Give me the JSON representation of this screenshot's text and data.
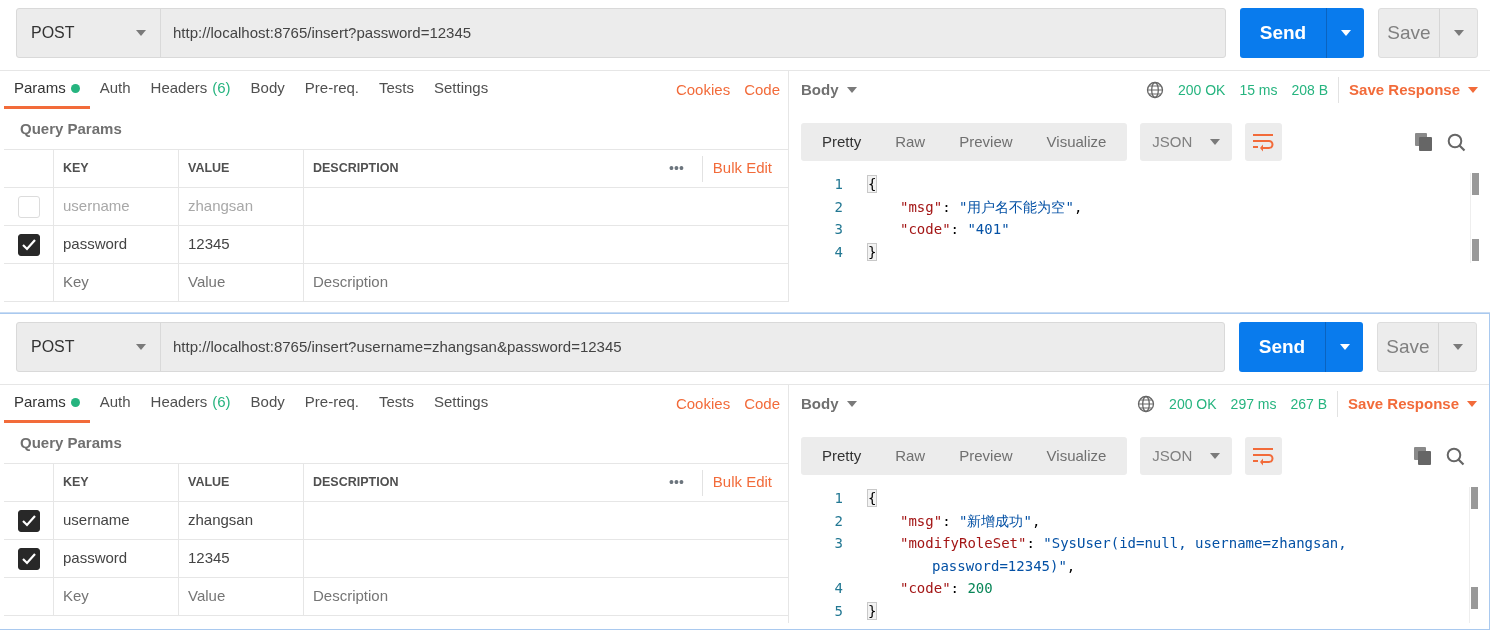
{
  "panels": [
    {
      "method": "POST",
      "url": "http://localhost:8765/insert?password=12345",
      "send": "Send",
      "save": "Save",
      "tabs": [
        {
          "label": "Params",
          "dot": true,
          "selected": true
        },
        {
          "label": "Auth",
          "selected": false
        },
        {
          "label": "Headers",
          "count": "(6)",
          "selected": false
        },
        {
          "label": "Body",
          "selected": false
        },
        {
          "label": "Pre-req.",
          "selected": false
        },
        {
          "label": "Tests",
          "selected": false
        },
        {
          "label": "Settings",
          "selected": false
        }
      ],
      "links": [
        "Cookies",
        "Code"
      ],
      "section_title": "Query Params",
      "columns": [
        "KEY",
        "VALUE",
        "DESCRIPTION"
      ],
      "more": "•••",
      "bulk_edit": "Bulk Edit",
      "rows": [
        {
          "key": "username",
          "value": "zhangsan",
          "checked": false
        },
        {
          "key": "password",
          "value": "12345",
          "checked": true
        }
      ],
      "new_row": {
        "key": {
          "placeholder": "Key"
        },
        "value": {
          "placeholder": "Value"
        },
        "description": {
          "placeholder": "Description"
        }
      },
      "response": {
        "body_label": "Body",
        "status": "200 OK",
        "time": "15 ms",
        "size": "208 B",
        "save_response": "Save Response",
        "view_tabs": [
          {
            "label": "Pretty",
            "selected": true
          },
          {
            "label": "Raw",
            "selected": false
          },
          {
            "label": "Preview",
            "selected": false
          },
          {
            "label": "Visualize",
            "selected": false
          }
        ],
        "format": "JSON",
        "lines": [
          {
            "kind": "brace",
            "number": "1",
            "tokens": [
              {
                "kind": "brace",
                "text": "{"
              }
            ]
          },
          {
            "kind": "member",
            "number": "2",
            "tokens": [
              {
                "kind": "key",
                "text": "\"msg\""
              },
              {
                "kind": "punct",
                "text": ": "
              },
              {
                "kind": "string",
                "text": "\"用户名不能为空\""
              },
              {
                "kind": "punct",
                "text": ","
              }
            ]
          },
          {
            "kind": "member",
            "number": "3",
            "tokens": [
              {
                "kind": "key",
                "text": "\"code\""
              },
              {
                "kind": "punct",
                "text": ": "
              },
              {
                "kind": "string",
                "text": "\"401\""
              }
            ]
          },
          {
            "kind": "brace",
            "number": "4",
            "tokens": [
              {
                "kind": "brace",
                "text": "}"
              }
            ]
          }
        ]
      }
    },
    {
      "method": "POST",
      "url": "http://localhost:8765/insert?username=zhangsan&password=12345",
      "send": "Send",
      "save": "Save",
      "tabs": [
        {
          "label": "Params",
          "dot": true,
          "selected": true
        },
        {
          "label": "Auth",
          "selected": false
        },
        {
          "label": "Headers",
          "count": "(6)",
          "selected": false
        },
        {
          "label": "Body",
          "selected": false
        },
        {
          "label": "Pre-req.",
          "selected": false
        },
        {
          "label": "Tests",
          "selected": false
        },
        {
          "label": "Settings",
          "selected": false
        }
      ],
      "links": [
        "Cookies",
        "Code"
      ],
      "section_title": "Query Params",
      "columns": [
        "KEY",
        "VALUE",
        "DESCRIPTION"
      ],
      "more": "•••",
      "bulk_edit": "Bulk Edit",
      "rows": [
        {
          "key": "username",
          "value": "zhangsan",
          "checked": true
        },
        {
          "key": "password",
          "value": "12345",
          "checked": true
        }
      ],
      "new_row": {
        "key": {
          "placeholder": "Key"
        },
        "value": {
          "placeholder": "Value"
        },
        "description": {
          "placeholder": "Description"
        }
      },
      "response": {
        "body_label": "Body",
        "status": "200 OK",
        "time": "297 ms",
        "size": "267 B",
        "save_response": "Save Response",
        "view_tabs": [
          {
            "label": "Pretty",
            "selected": true
          },
          {
            "label": "Raw",
            "selected": false
          },
          {
            "label": "Preview",
            "selected": false
          },
          {
            "label": "Visualize",
            "selected": false
          }
        ],
        "format": "JSON",
        "lines": [
          {
            "kind": "brace",
            "number": "1",
            "tokens": [
              {
                "kind": "brace",
                "text": "{"
              }
            ]
          },
          {
            "kind": "member",
            "number": "2",
            "tokens": [
              {
                "kind": "key",
                "text": "\"msg\""
              },
              {
                "kind": "punct",
                "text": ": "
              },
              {
                "kind": "string",
                "text": "\"新增成功\""
              },
              {
                "kind": "punct",
                "text": ","
              }
            ]
          },
          {
            "kind": "member",
            "number": "3",
            "tokens": [
              {
                "kind": "key",
                "text": "\"modifyRoleSet\""
              },
              {
                "kind": "punct",
                "text": ": "
              },
              {
                "kind": "string",
                "text": "\"SysUser(id=null, username=zhangsan,"
              }
            ]
          },
          {
            "kind": "wrap",
            "tokens": [
              {
                "kind": "string",
                "text": "password=12345)\""
              },
              {
                "kind": "punct",
                "text": ","
              }
            ]
          },
          {
            "kind": "member",
            "number": "4",
            "tokens": [
              {
                "kind": "key",
                "text": "\"code\""
              },
              {
                "kind": "punct",
                "text": ": "
              },
              {
                "kind": "number",
                "text": "200"
              }
            ]
          },
          {
            "kind": "brace",
            "number": "5",
            "tokens": [
              {
                "kind": "brace",
                "text": "}"
              }
            ]
          }
        ]
      }
    }
  ]
}
